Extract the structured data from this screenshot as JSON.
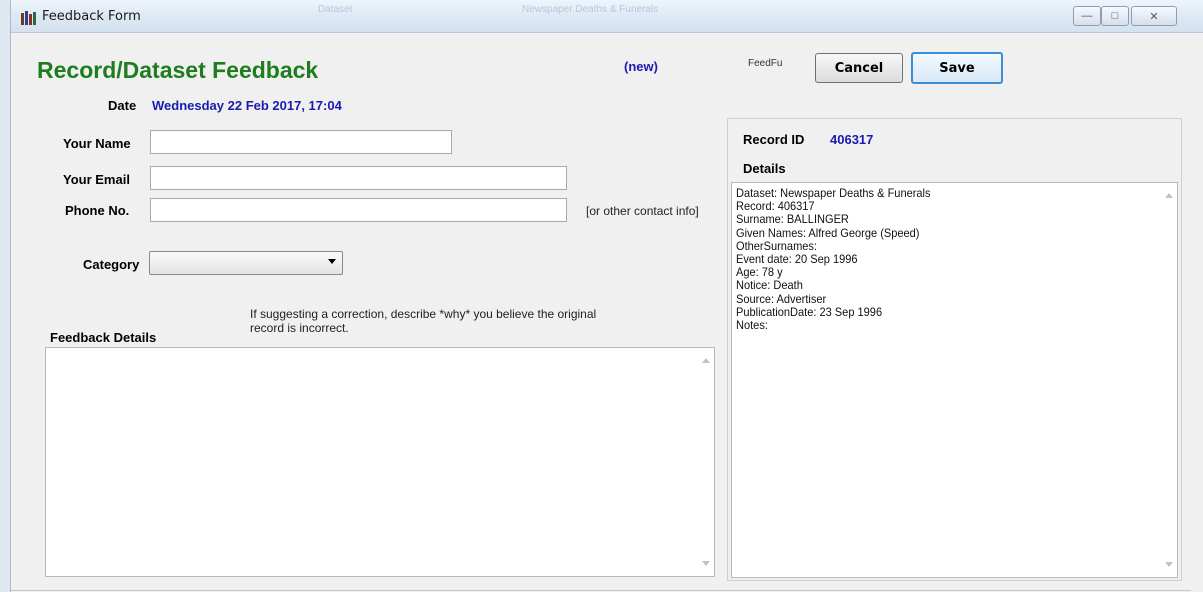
{
  "window": {
    "title": "Feedback Form",
    "background_ghost_text": [
      "Dataset",
      "Newspaper Deaths & Funerals"
    ],
    "controls": {
      "minimize": "—",
      "maximize": "□",
      "close": "✕"
    }
  },
  "header": {
    "heading": "Record/Dataset Feedback",
    "status_tag": "(new)",
    "form_code": "FeedFu",
    "cancel_label": "Cancel",
    "save_label": "Save"
  },
  "form": {
    "date_label": "Date",
    "date_value": "Wednesday 22 Feb 2017, 17:04",
    "name_label": "Your Name",
    "name_value": "",
    "email_label": "Your Email",
    "email_value": "",
    "phone_label": "Phone No.",
    "phone_value": "",
    "phone_hint": "[or other contact info]",
    "category_label": "Category",
    "category_value": "",
    "feedback_label": "Feedback Details",
    "feedback_hint_line1": "If suggesting a correction, describe *why* you believe the original",
    "feedback_hint_line2": "record is incorrect.",
    "feedback_value": ""
  },
  "record": {
    "id_label": "Record ID",
    "id_value": "406317",
    "details_label": "Details",
    "details_lines": [
      "Dataset: Newspaper Deaths & Funerals",
      "Record: 406317",
      "Surname: BALLINGER",
      "Given Names: Alfred George (Speed)",
      "OtherSurnames:",
      "Event date: 20 Sep 1996",
      "Age: 78 y",
      "Notice: Death",
      "Source: Advertiser",
      "PublicationDate: 23 Sep 1996",
      "Notes:"
    ]
  },
  "colors": {
    "heading_green": "#1e7d1e",
    "value_blue": "#1a1ab0",
    "save_border": "#3c8fd6"
  }
}
